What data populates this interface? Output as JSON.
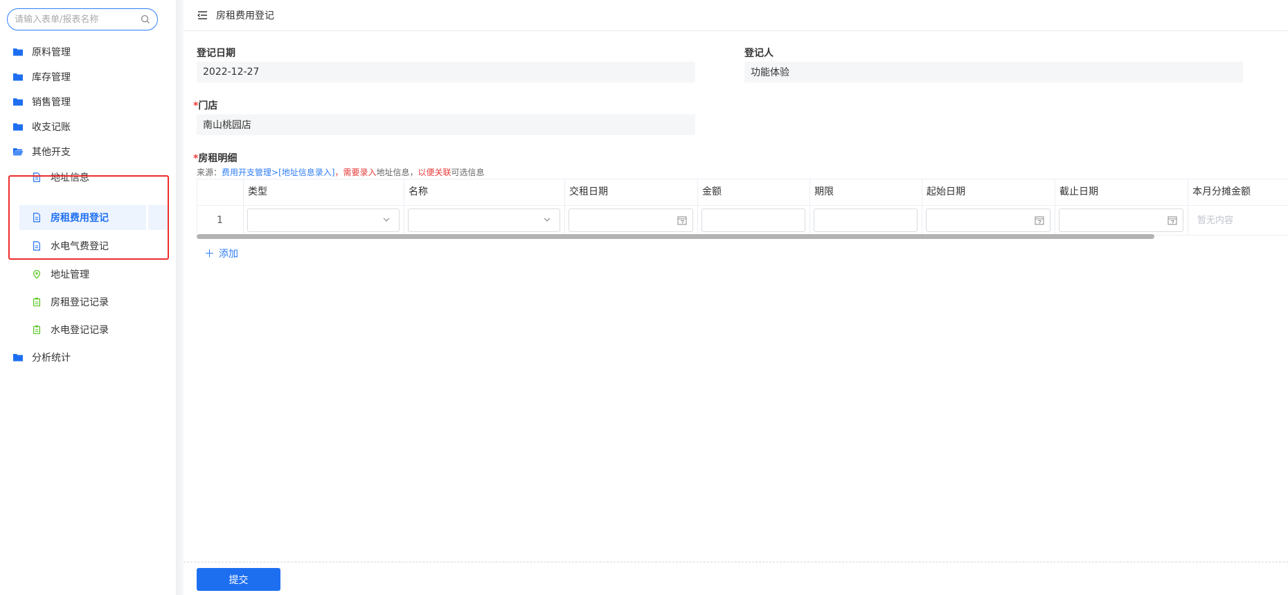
{
  "sidebar": {
    "search_placeholder": "请输入表单/报表名称",
    "items": [
      {
        "label": "原料管理",
        "icon": "folder-icon"
      },
      {
        "label": "库存管理",
        "icon": "folder-icon"
      },
      {
        "label": "销售管理",
        "icon": "folder-icon"
      },
      {
        "label": "收支记账",
        "icon": "folder-icon"
      },
      {
        "label": "其他开支",
        "icon": "folder-open-icon"
      },
      {
        "label": "地址信息",
        "icon": "document-icon"
      },
      {
        "label": "房租费用登记",
        "icon": "document-icon",
        "active": true
      },
      {
        "label": "水电气费登记",
        "icon": "document-icon"
      },
      {
        "label": "地址管理",
        "icon": "location-pin-icon"
      },
      {
        "label": "房租登记记录",
        "icon": "clipboard-icon"
      },
      {
        "label": "水电登记记录",
        "icon": "clipboard-icon"
      },
      {
        "label": "分析统计",
        "icon": "folder-icon"
      }
    ]
  },
  "header": {
    "title": "房租费用登记"
  },
  "form": {
    "reg_date_label": "登记日期",
    "reg_date_value": "2022-12-27",
    "registrant_label": "登记人",
    "registrant_value": "功能体验",
    "store_label": "门店",
    "store_value": "南山桃园店",
    "detail_label": "房租明细",
    "required_mark": "*"
  },
  "source_note": {
    "prefix": "来源：",
    "link": "费用开支管理>[地址信息录入]",
    "sep": "，",
    "need": "需要录入",
    "mid": "地址信息，",
    "relate": "以便关联",
    "suffix": "可选信息"
  },
  "table": {
    "columns": [
      "类型",
      "名称",
      "交租日期",
      "金额",
      "期限",
      "起始日期",
      "截止日期",
      "本月分摊金额"
    ],
    "row_number": "1",
    "empty_text": "暂无内容"
  },
  "add_label": "添加",
  "submit_label": "提交",
  "colors": {
    "accent": "#1e6ff0",
    "highlight_box": "#ee2b2b",
    "folder": "#1e6ff0",
    "green_icon": "#52c41a"
  }
}
